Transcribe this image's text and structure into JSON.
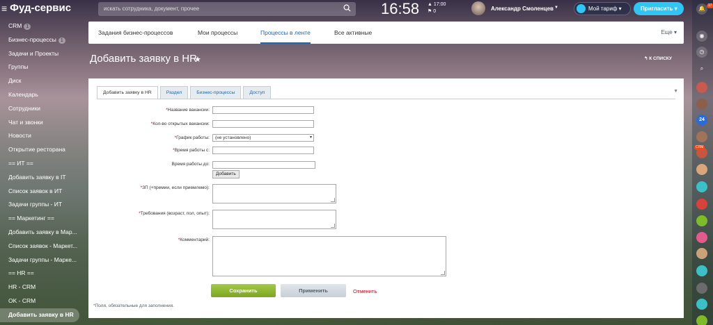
{
  "app": {
    "title": "Фуд-сервис"
  },
  "search": {
    "placeholder": "искать сотрудника, документ, прочее"
  },
  "clock": {
    "time": "16:58",
    "alarm": "17:00",
    "flag_count": "0"
  },
  "user": {
    "name": "Александр Смоленцев"
  },
  "header_buttons": {
    "tariff": "Мой тариф",
    "invite": "Пригласить"
  },
  "sidebar": {
    "items": [
      {
        "label": "CRM",
        "counter": "1"
      },
      {
        "label": "Бизнес-процессы",
        "counter": "1"
      },
      {
        "label": "Задачи и Проекты"
      },
      {
        "label": "Группы"
      },
      {
        "label": "Диск"
      },
      {
        "label": "Календарь"
      },
      {
        "label": "Сотрудники"
      },
      {
        "label": "Чат и звонки"
      },
      {
        "label": "Новости"
      },
      {
        "label": "Открытие ресторана"
      },
      {
        "label": "== ИТ =="
      },
      {
        "label": "Добавить заявку в IT"
      },
      {
        "label": "Список заявок в ИТ"
      },
      {
        "label": "Задачи группы - ИТ"
      },
      {
        "label": "== Маркетинг =="
      },
      {
        "label": "Добавить заявку в Мар..."
      },
      {
        "label": "Список заявок - Маркет..."
      },
      {
        "label": "Задачи группы - Марке..."
      },
      {
        "label": "== HR =="
      },
      {
        "label": "HR - CRM"
      },
      {
        "label": "OK - CRM"
      },
      {
        "label": "Добавить заявку в HR"
      }
    ]
  },
  "rail": {
    "notification_count": "17",
    "badge_24": "24",
    "badge_crm": "CRM"
  },
  "top_tabs": {
    "tab1": "Задания бизнес-процессов",
    "tab2": "Мои процессы",
    "tab3": "Процессы в ленте",
    "tab4": "Все активные",
    "more": "Еще"
  },
  "page": {
    "title": "Добавить заявку в HR",
    "back_link": "К СПИСКУ"
  },
  "form_tabs": {
    "tab1": "Добавить заявку в HR",
    "tab2": "Раздел",
    "tab3": "Бизнес-процессы",
    "tab4": "Доступ"
  },
  "form": {
    "vacancy_label": "Название вакансии:",
    "count_label": "Кол-во открытых вакансии:",
    "schedule_label": "График работы:",
    "schedule_value": "(не установлено)",
    "time_from_label": "Время работы с:",
    "time_to_label": "Время работы до:",
    "add_button": "Добавить",
    "salary_label": "ЗП (+премии, если приемлемо):",
    "requirements_label": "Требования (возраст, пол, опыт):",
    "comment_label": "Комментарий:",
    "required_mark": "*",
    "save": "Сохранить",
    "apply": "Применить",
    "cancel": "Отменить",
    "footnote": "*Поля, обязательные для заполнения."
  },
  "colors": {
    "accent": "#2067b0",
    "save_green": "#7ea61e",
    "invite_blue": "#2fc6f6",
    "required_red": "#d0021b"
  }
}
